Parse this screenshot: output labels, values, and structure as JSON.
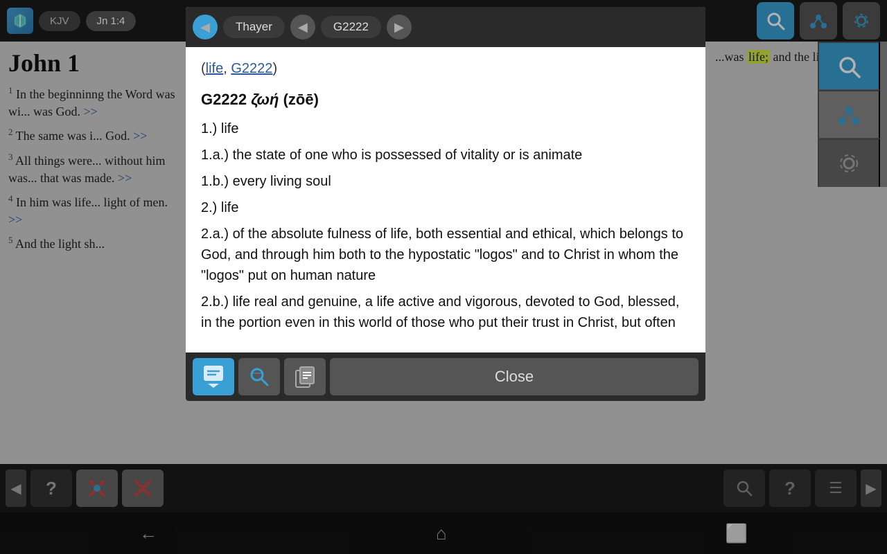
{
  "app": {
    "icon": "📖",
    "version_label": "KJV",
    "reference_label": "Jn 1:4"
  },
  "top_bar": {
    "back_icon": "◀",
    "refresh_icon": "↺"
  },
  "bible": {
    "chapter_title": "John 1",
    "verses": [
      {
        "number": "1",
        "text": "In the beginninng",
        "continuation": "the Word was wi",
        "end": "was God."
      },
      {
        "number": "2",
        "text": "The same was i",
        "end": "God."
      },
      {
        "number": "3",
        "text": "All things were",
        "continuation": "without him was",
        "end": "that was made."
      },
      {
        "number": "4",
        "text": "In him was life",
        "continuation": "light of men."
      },
      {
        "number": "5",
        "text": "And the light sh"
      }
    ],
    "right_text": "was life; and the light of",
    "double_arrow": ">>",
    "link_goto": ">>"
  },
  "modal": {
    "header": {
      "back_arrow": "◀",
      "lexicon_label": "Thayer",
      "left_chevron": "◀",
      "strongs_number": "G2222",
      "right_chevron": "▶"
    },
    "links": {
      "open_paren": "(",
      "link1": "life",
      "comma": ",",
      "link2": "G2222",
      "close_paren": ")"
    },
    "entry": {
      "strongs": "G2222",
      "greek_word": "ζωή",
      "transliteration": "(zōē)",
      "definitions": [
        "1.) life",
        "1.a.) the state of one who is possessed of vitality or is animate",
        "1.b.) every living soul",
        "2.) life",
        "2.a.) of the absolute fulness of life, both essential and ethical, which belongs to God, and through him both to the hypostatic \"logos\" and to Christ in whom the \"logos\" put on human nature",
        "2.b.) life real and genuine, a life active and vigorous, devoted to God, blessed, in the portion even in this world of those who put their trust in Christ, but often"
      ]
    },
    "footer": {
      "icon1": "👆",
      "icon2": "🔍",
      "icon3": "📋",
      "close_label": "Close"
    }
  },
  "bottom_bar": {
    "left_arrow": "◀",
    "btn1_icon": "?",
    "btn2_icon": "✂",
    "btn3_icon": "✂",
    "right_arrow": "▶",
    "right_icons": {
      "search": "🔍",
      "help": "?",
      "list": "☰"
    }
  },
  "android_nav": {
    "back": "←",
    "home": "⌂",
    "recents": "⬜"
  }
}
